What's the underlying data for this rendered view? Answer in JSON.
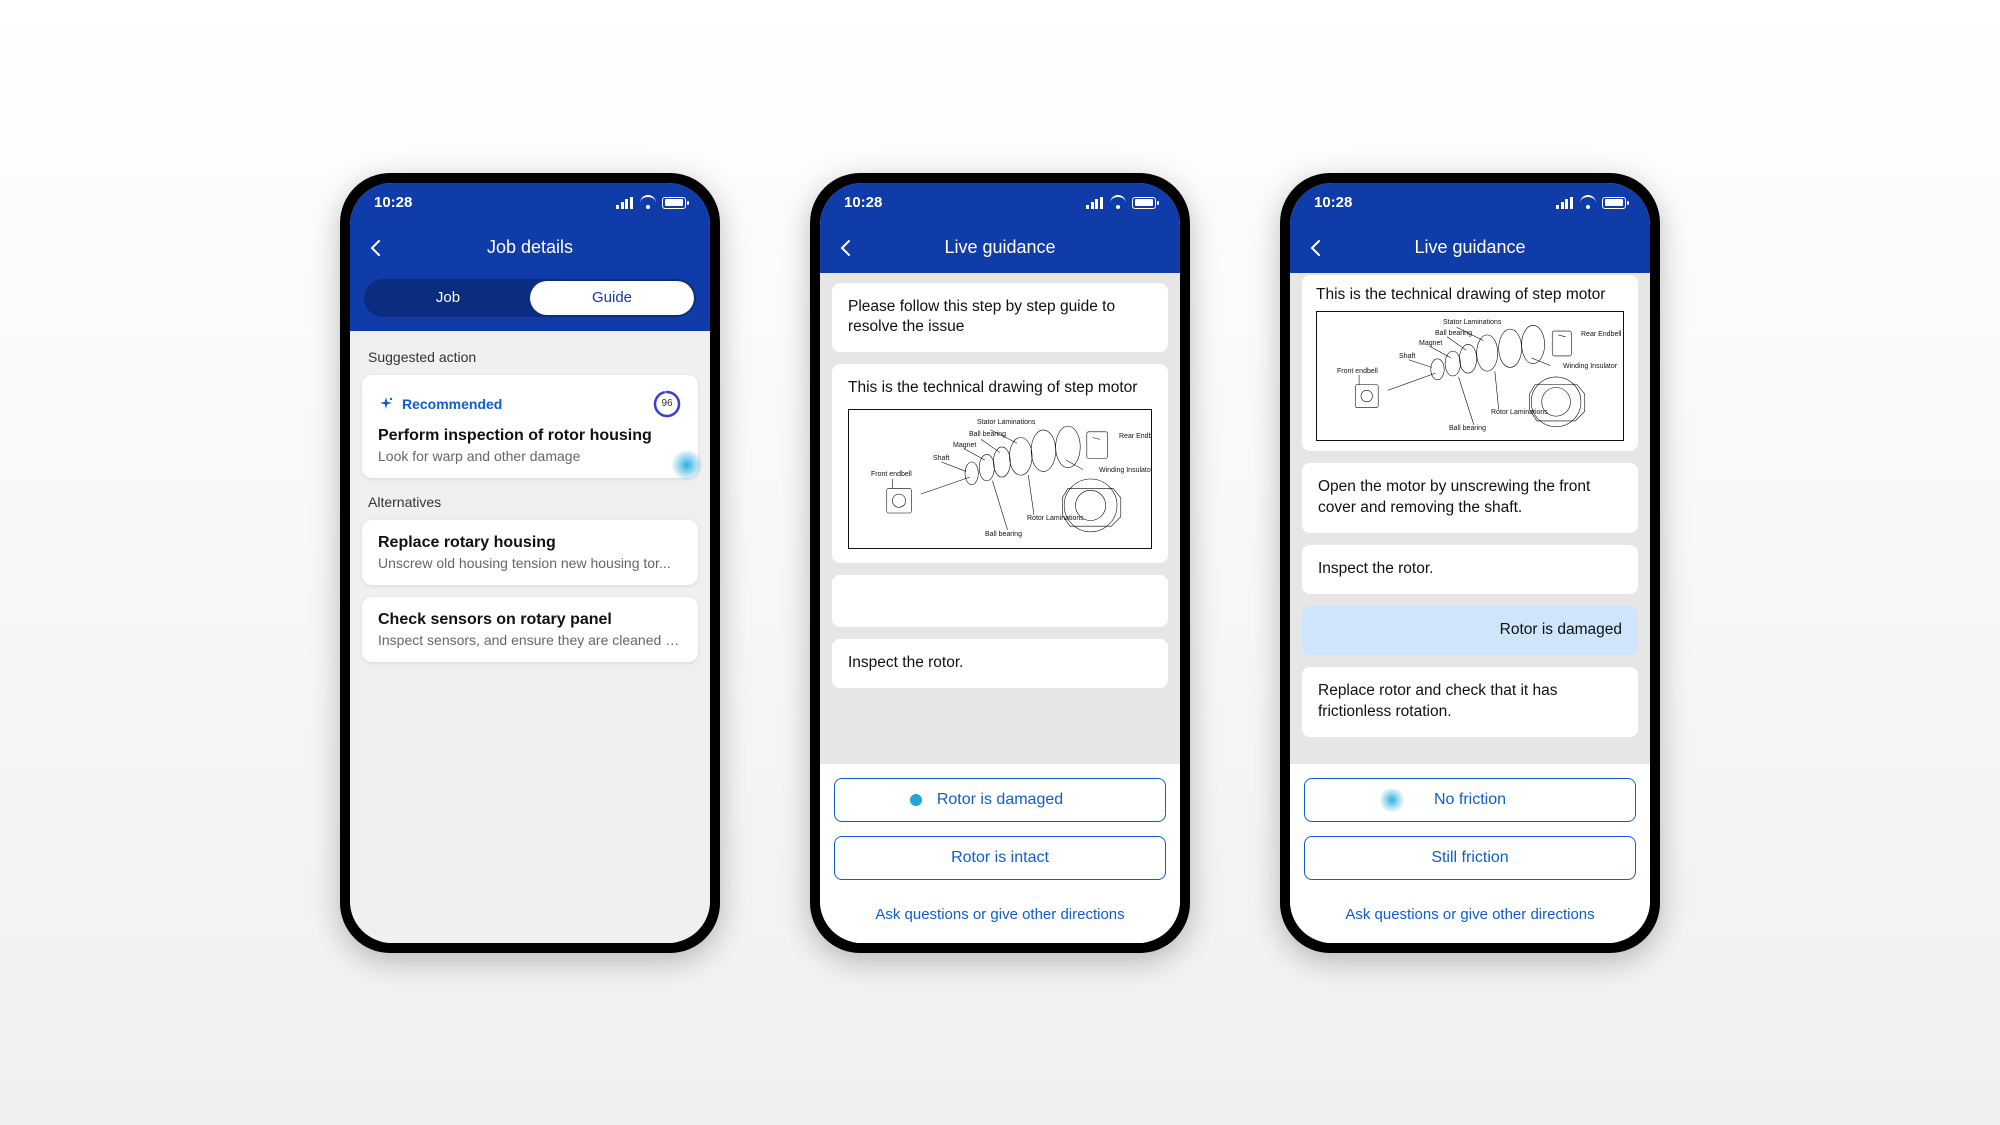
{
  "status": {
    "time": "10:28"
  },
  "screen1": {
    "title": "Job details",
    "tabs": {
      "job": "Job",
      "guide": "Guide"
    },
    "suggested_label": "Suggested action",
    "recommended_label": "Recommended",
    "score": "96",
    "rec_card": {
      "title": "Perform inspection of rotor housing",
      "sub": "Look for warp and other damage"
    },
    "alternatives_label": "Alternatives",
    "alt1": {
      "title": "Replace rotary housing",
      "sub": "Unscrew old housing tension new housing tor..."
    },
    "alt2": {
      "title": "Check sensors on rotary panel",
      "sub": "Inspect sensors, and ensure they are cleaned o..."
    }
  },
  "screen2": {
    "title": "Live guidance",
    "step_intro": "Please follow this step by step guide to resolve the issue",
    "step_drawing": "This is the technical drawing of step motor",
    "step_inspect": "Inspect the rotor.",
    "choice1": "Rotor is damaged",
    "choice2": "Rotor is intact",
    "ask_link": "Ask questions or give other directions"
  },
  "screen3": {
    "title": "Live guidance",
    "step_drawing": "This is the technical drawing of step motor",
    "step_open": "Open the motor by unscrewing the front cover and removing the shaft.",
    "step_inspect": "Inspect the rotor.",
    "user_reply": "Rotor is damaged",
    "step_replace": "Replace rotor and check that it has frictionless rotation.",
    "choice1": "No friction",
    "choice2": "Still friction",
    "ask_link": "Ask questions or give other directions"
  },
  "drawing": {
    "stator": "Stator Laminations",
    "ball": "Ball bearing",
    "magnet": "Magnet",
    "shaft": "Shaft",
    "front": "Front endbell",
    "rear": "Rear Endbell",
    "winding": "Winding Insulator",
    "rotor": "Rotor Laminations"
  }
}
